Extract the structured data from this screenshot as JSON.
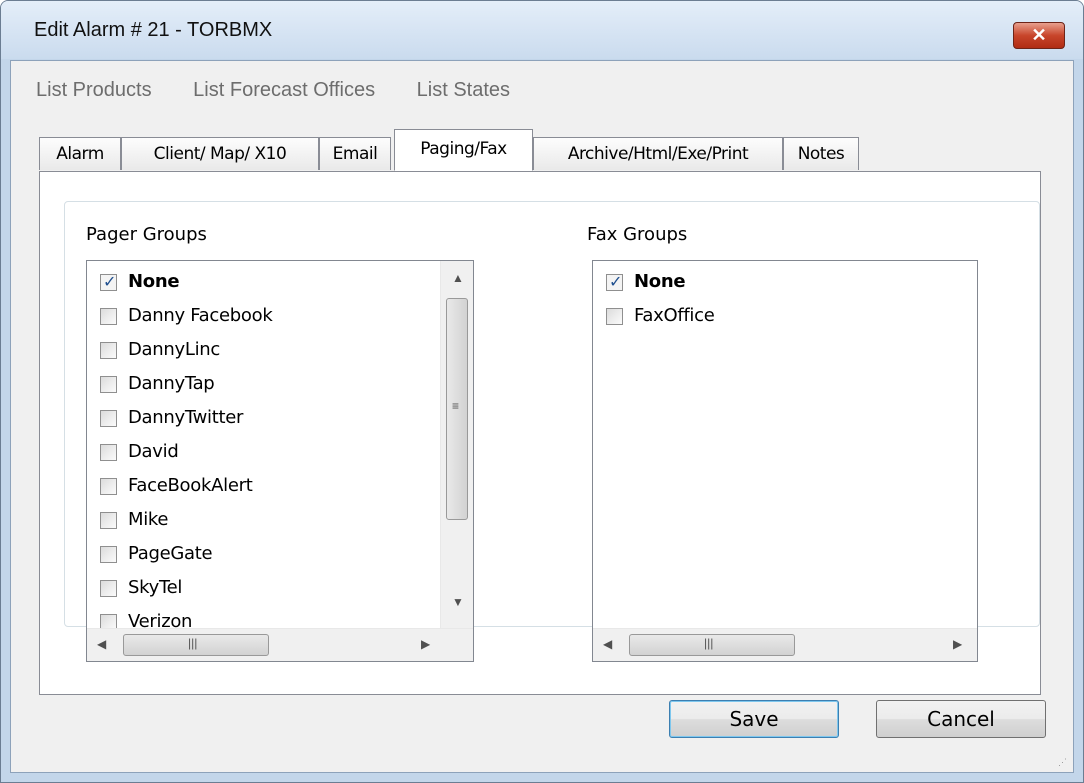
{
  "window": {
    "title": "Edit Alarm # 21 - TORBMX",
    "close_glyph": "✕"
  },
  "menu": {
    "items": [
      "List Products",
      "List Forecast Offices",
      "List States"
    ]
  },
  "tabs": [
    "Alarm",
    "Client/ Map/ X10",
    "Email",
    "Paging/Fax",
    "Archive/Html/Exe/Print",
    "Notes"
  ],
  "active_tab": "Paging/Fax",
  "pager_groups": {
    "label": "Pager Groups",
    "items": [
      {
        "label": "None",
        "checked": true
      },
      {
        "label": "Danny Facebook",
        "checked": false
      },
      {
        "label": "DannyLinc",
        "checked": false
      },
      {
        "label": "DannyTap",
        "checked": false
      },
      {
        "label": "DannyTwitter",
        "checked": false
      },
      {
        "label": "David",
        "checked": false
      },
      {
        "label": "FaceBookAlert",
        "checked": false
      },
      {
        "label": "Mike",
        "checked": false
      },
      {
        "label": "PageGate",
        "checked": false
      },
      {
        "label": "SkyTel",
        "checked": false
      },
      {
        "label": "Verizon",
        "checked": false
      }
    ]
  },
  "fax_groups": {
    "label": "Fax Groups",
    "items": [
      {
        "label": "None",
        "checked": true
      },
      {
        "label": "FaxOffice",
        "checked": false
      }
    ]
  },
  "buttons": {
    "save": "Save",
    "cancel": "Cancel"
  },
  "icons": {
    "check": "check-icon",
    "up": "scroll-up-arrow-icon",
    "down": "scroll-down-arrow-icon",
    "left": "scroll-left-arrow-icon",
    "right": "scroll-right-arrow-icon"
  },
  "colors": {
    "title_bar": "#cadbee",
    "close_button": "#c8452b",
    "default_button_border": "#3c7fb1",
    "check": "#21508f"
  }
}
